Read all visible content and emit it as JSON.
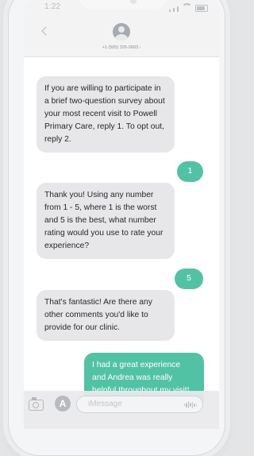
{
  "status": {
    "time": "1:22"
  },
  "header": {
    "contact_number": "+1 (585) 326-0683 ›"
  },
  "messages": [
    {
      "direction": "in",
      "text": "If you are willing to participate in a brief two-question survey about your most recent visit to Powell Primary Care, reply 1. To opt out, reply 2."
    },
    {
      "direction": "out",
      "text": "1"
    },
    {
      "direction": "in",
      "text": "Thank you! Using any number from 1 - 5, where 1 is the worst and 5 is the best, what number rating would you use to rate your experience?"
    },
    {
      "direction": "out",
      "text": "5"
    },
    {
      "direction": "in",
      "text": "That's fantastic! Are there any other comments you'd like to provide for our clinic."
    },
    {
      "direction": "out",
      "text": "I had a great experience and Andrea was really helpful throughout my visit!"
    }
  ],
  "composer": {
    "placeholder": "iMessage",
    "app_store_glyph": "A"
  },
  "icons": [
    "back-chevron-icon",
    "contact-avatar-icon",
    "signal-icon",
    "wifi-icon",
    "battery-icon",
    "camera-icon",
    "app-store-icon",
    "audio-wave-icon"
  ],
  "colors": {
    "outgoing_bubble": "#52c2a5",
    "incoming_bubble": "#e7e7ea"
  }
}
